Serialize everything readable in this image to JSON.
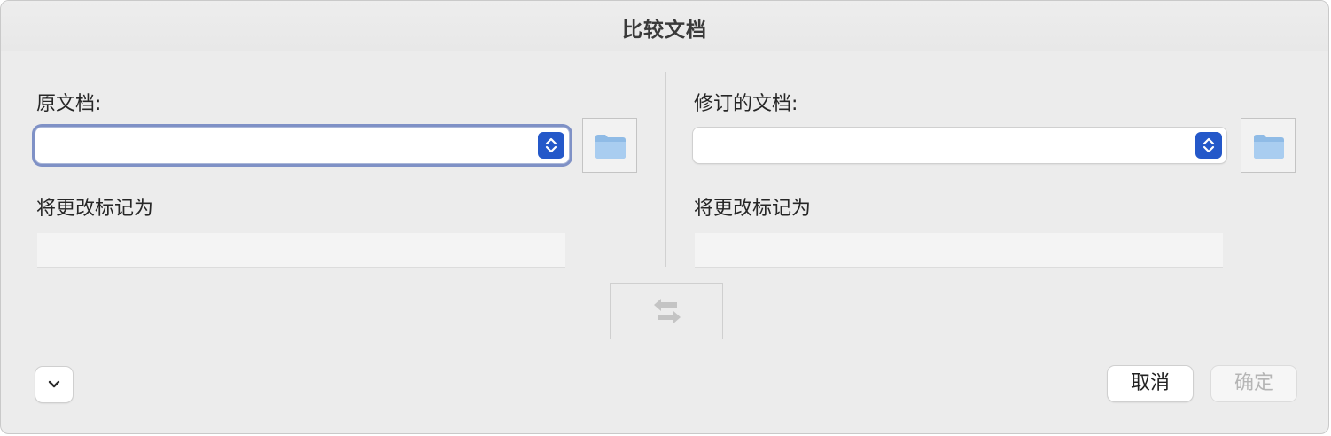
{
  "dialog": {
    "title": "比较文档"
  },
  "original": {
    "label": "原文档:",
    "select_value": "",
    "mark_changes_label": "将更改标记为",
    "mark_changes_value": ""
  },
  "revised": {
    "label": "修订的文档:",
    "select_value": "",
    "mark_changes_label": "将更改标记为",
    "mark_changes_value": ""
  },
  "buttons": {
    "cancel_label": "取消",
    "ok_label": "确定"
  },
  "icons": {
    "folder": "folder-icon",
    "stepper": "up-down-chevron-icon",
    "swap": "swap-arrows-icon",
    "disclosure": "chevron-down-icon"
  },
  "colors": {
    "accent": "#2458c9",
    "focus_ring": "#7f91c6",
    "disabled_text": "#b5b5b5"
  }
}
